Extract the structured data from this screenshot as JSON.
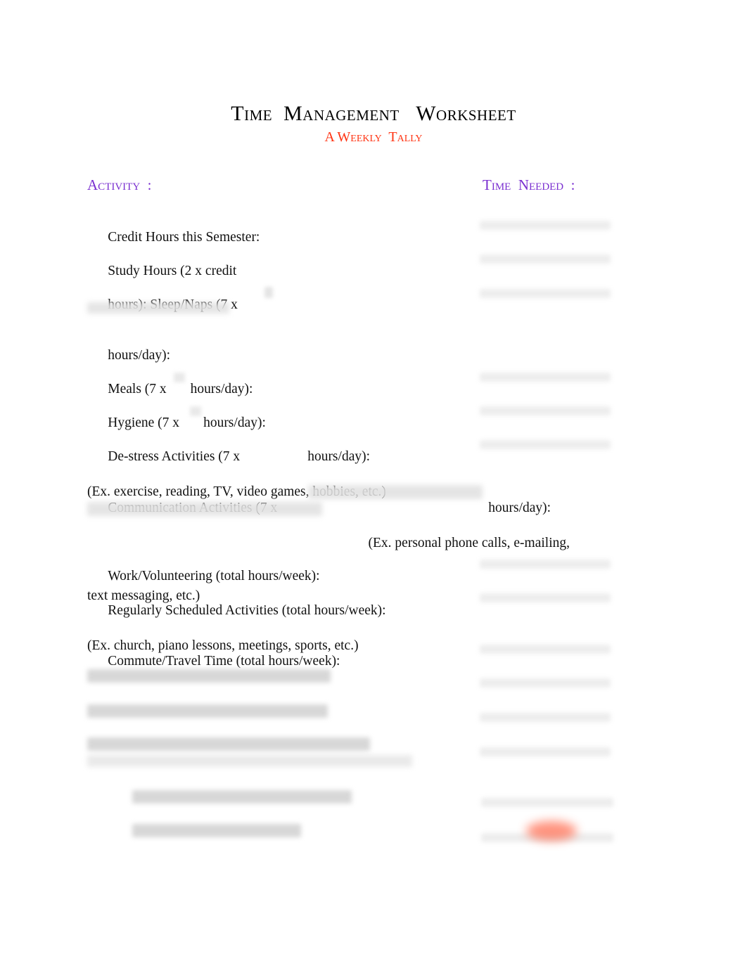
{
  "document": {
    "title": "Time  Management   Worksheet",
    "subtitle": "A Weekly  Tally"
  },
  "headers": {
    "activity": "Activity  :",
    "time_needed": "Time  Needed  :"
  },
  "rows": [
    {
      "id": "credit-hours",
      "label": "Credit Hours this Semester:",
      "note": "",
      "has_blank": true,
      "redacted": false
    },
    {
      "id": "study-hours",
      "label": "Study Hours (2 x credit",
      "note": "",
      "has_blank": true,
      "redacted": false
    },
    {
      "id": "sleep-naps",
      "label": "hours): Sleep/Naps (7 x",
      "note": "",
      "has_blank": true,
      "redacted": true
    },
    {
      "id": "hours-per-day-continuation",
      "label": "hours/day):",
      "note": "",
      "has_blank": false,
      "redacted": false
    },
    {
      "id": "meals",
      "label_before": "Meals (7 x",
      "label_after": "hours/day):",
      "note": "",
      "has_blank": true,
      "redacted": false
    },
    {
      "id": "hygiene",
      "label_before": "Hygiene (7 x",
      "label_after": "hours/day):",
      "note": "",
      "has_blank": true,
      "redacted": false
    },
    {
      "id": "de-stress-activities",
      "label_before": "De-stress Activities (7 x",
      "label_after": "hours/day):",
      "note": "(Ex. exercise, reading, TV, video games, hobbies, etc.)",
      "has_blank": true,
      "redacted": false
    },
    {
      "id": "communication-activities",
      "label_before": "Communication Activities (7 x",
      "label_after": "hours/day):",
      "note_line_1": "(Ex. personal phone calls, e-mailing,",
      "note_line_2": "text messaging, etc.)",
      "has_blank": false,
      "redacted": true
    },
    {
      "id": "work-volunteering",
      "label": "Work/Volunteering (total hours/week):",
      "note": "",
      "has_blank": true,
      "redacted": false
    },
    {
      "id": "regularly-scheduled-activities",
      "label": "Regularly Scheduled Activities (total hours/week):",
      "note": "(Ex. church, piano lessons, meetings, sports, etc.)",
      "has_blank": true,
      "redacted": false
    },
    {
      "id": "commute-travel-time",
      "label": "Commute/Travel Time (total hours/week):",
      "note": "",
      "has_blank": true,
      "redacted": false
    },
    {
      "id": "redacted-row-1",
      "label": "",
      "note": "",
      "has_blank": true,
      "redacted": true
    },
    {
      "id": "redacted-row-2",
      "label": "",
      "note": "",
      "has_blank": true,
      "redacted": true
    },
    {
      "id": "redacted-row-3",
      "label": "",
      "note": "",
      "has_blank": true,
      "redacted": true
    },
    {
      "id": "redacted-total-row",
      "label": "",
      "note": "",
      "has_blank": true,
      "redacted": true
    },
    {
      "id": "redacted-hours-in-week-row",
      "label": "",
      "note": "",
      "has_blank": true,
      "redacted": true
    }
  ],
  "colors": {
    "title": "#000000",
    "subtitle_red": "#FF3413",
    "header_purple": "#7A2FD0",
    "body_text": "#111111",
    "blank_line": "#ececec",
    "redacted_gray": "#bfbfbf",
    "red_highlight": "#ff6a4d"
  }
}
